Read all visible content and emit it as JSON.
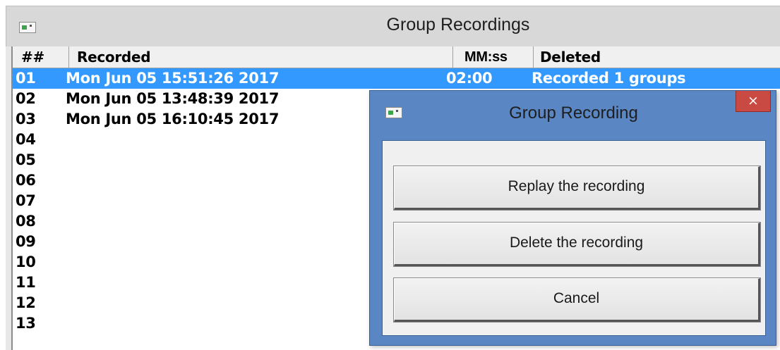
{
  "main_window": {
    "title": "Group Recordings",
    "icon": "app-window-icon"
  },
  "table": {
    "columns": {
      "num": "##",
      "recorded": "Recorded",
      "mmss": "MM:ss",
      "deleted": "Deleted"
    },
    "selected_row": 0,
    "rows": [
      {
        "num": "01",
        "recorded": "Mon Jun 05 15:51:26 2017",
        "mmss": "02:00",
        "deleted": "Recorded 1 groups"
      },
      {
        "num": "02",
        "recorded": "Mon Jun 05 13:48:39 2017",
        "mmss": "",
        "deleted": ""
      },
      {
        "num": "03",
        "recorded": "Mon Jun 05 16:10:45 2017",
        "mmss": "",
        "deleted": ""
      },
      {
        "num": "04",
        "recorded": "",
        "mmss": "",
        "deleted": ""
      },
      {
        "num": "05",
        "recorded": "",
        "mmss": "",
        "deleted": ""
      },
      {
        "num": "06",
        "recorded": "",
        "mmss": "",
        "deleted": ""
      },
      {
        "num": "07",
        "recorded": "",
        "mmss": "",
        "deleted": ""
      },
      {
        "num": "08",
        "recorded": "",
        "mmss": "",
        "deleted": ""
      },
      {
        "num": "09",
        "recorded": "",
        "mmss": "",
        "deleted": ""
      },
      {
        "num": "10",
        "recorded": "",
        "mmss": "",
        "deleted": ""
      },
      {
        "num": "11",
        "recorded": "",
        "mmss": "",
        "deleted": ""
      },
      {
        "num": "12",
        "recorded": "",
        "mmss": "",
        "deleted": ""
      },
      {
        "num": "13",
        "recorded": "",
        "mmss": "",
        "deleted": ""
      }
    ]
  },
  "dialog": {
    "title": "Group Recording",
    "close_label": "×",
    "buttons": {
      "replay": "Replay the recording",
      "delete": "Delete the recording",
      "cancel": "Cancel"
    }
  },
  "colors": {
    "selection": "#3399ff",
    "dialog_frame": "#5a87c3",
    "close_button": "#c94a43"
  }
}
